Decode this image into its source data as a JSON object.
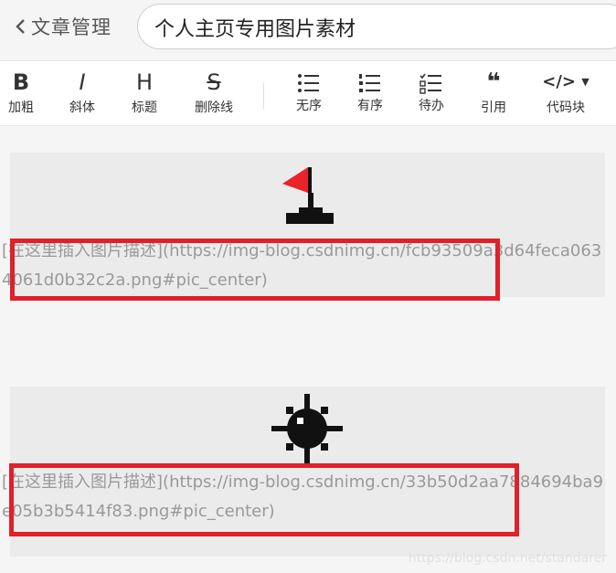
{
  "header": {
    "back_label": "文章管理",
    "title_value": "个人主页专用图片素材"
  },
  "toolbar": {
    "items": [
      {
        "glyph": "B",
        "label": "加粗",
        "icon": "bold-icon"
      },
      {
        "glyph": "I",
        "label": "斜体",
        "icon": "italic-icon"
      },
      {
        "glyph": "H",
        "label": "标题",
        "icon": "heading-icon"
      },
      {
        "glyph": "S",
        "label": "删除线",
        "icon": "strikethrough-icon"
      },
      {
        "glyph": "",
        "label": "无序",
        "icon": "unordered-list-icon"
      },
      {
        "glyph": "",
        "label": "有序",
        "icon": "ordered-list-icon"
      },
      {
        "glyph": "",
        "label": "待办",
        "icon": "todo-list-icon"
      },
      {
        "glyph": "❝",
        "label": "引用",
        "icon": "quote-icon"
      },
      {
        "glyph": "</>",
        "label": "代码块",
        "icon": "code-block-icon"
      }
    ]
  },
  "editor": {
    "image1": {
      "icon": "flag-icon",
      "text": "[在这里插入图片描述](https://img-blog.csdnimg.cn/fcb93509a3d64feca0634061d0b32c2a.png#pic_center)"
    },
    "image2": {
      "icon": "mine-icon",
      "text": "[在这里插入图片描述](https://img-blog.csdnimg.cn/33b50d2aa7884694ba9e05b3b5414f83.png#pic_center)"
    }
  },
  "watermark": "https://blog.csdn.net/standarer",
  "colors": {
    "highlight_box": "#e0202a",
    "block_bg": "#ebebeb",
    "md_text": "#999999"
  }
}
